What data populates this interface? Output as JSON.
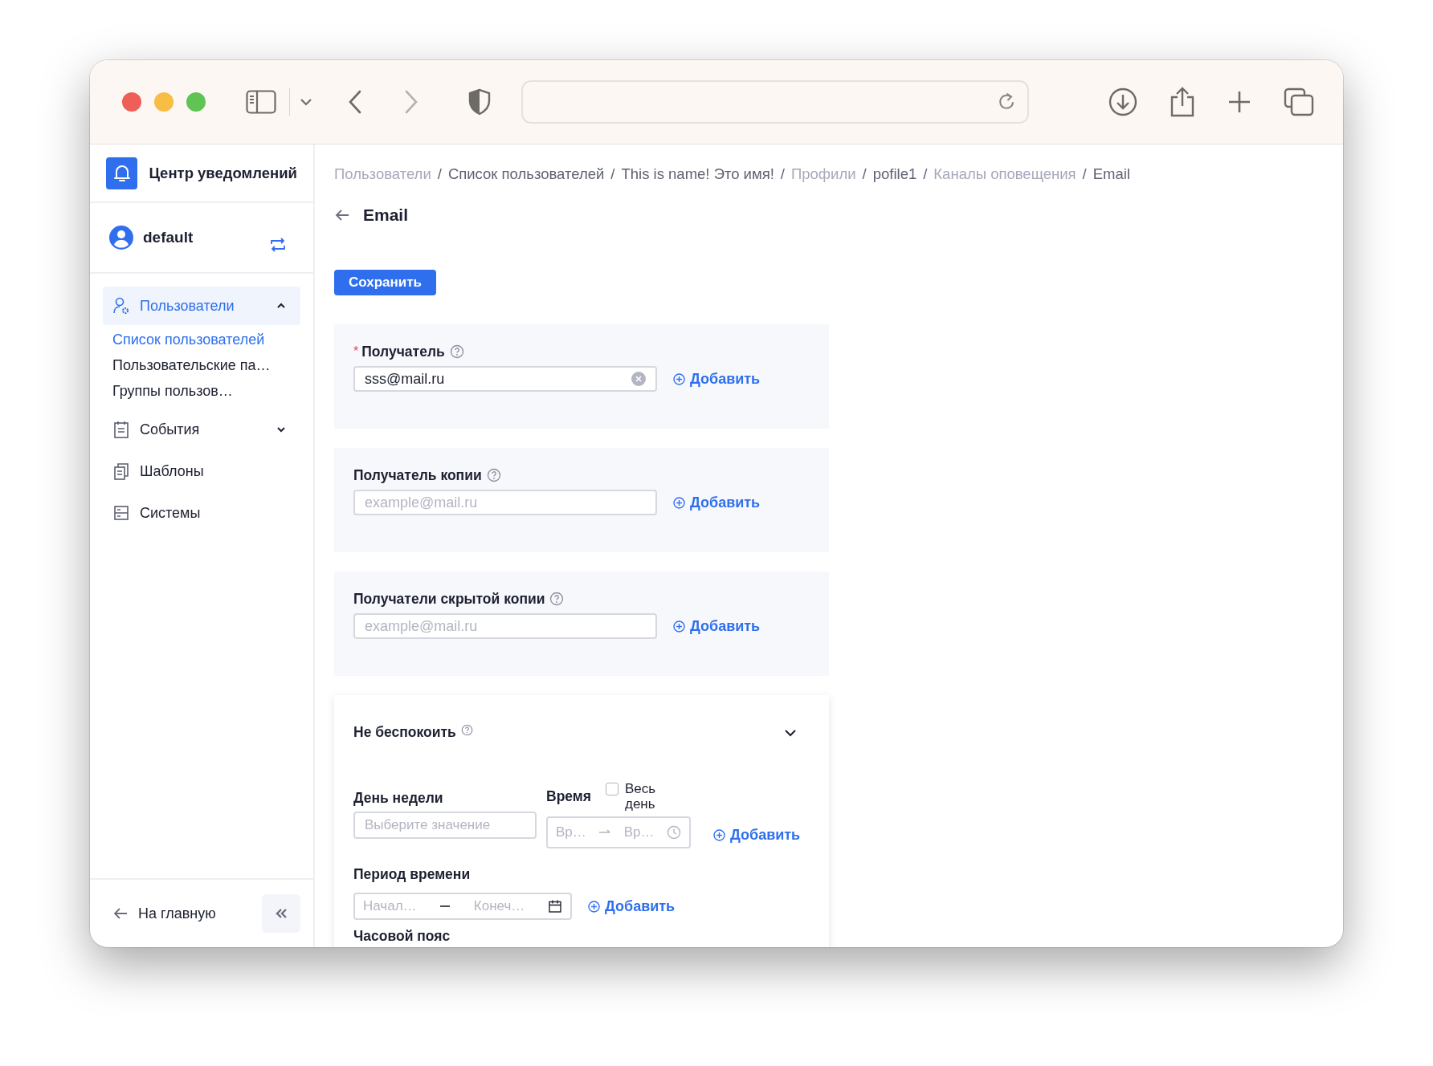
{
  "sidebar": {
    "app_title": "Центр уведомлений",
    "user": {
      "name": "default"
    },
    "nav": [
      {
        "label": "Пользователи",
        "kind": "users",
        "selected": true,
        "expanded": true,
        "children": [
          {
            "label": "Список пользователей",
            "selected": true
          },
          {
            "label": "Пользовательские па…",
            "selected": false
          },
          {
            "label": "Группы пользов…",
            "selected": false
          }
        ]
      },
      {
        "label": "События",
        "kind": "events",
        "selected": false,
        "expanded": false
      },
      {
        "label": "Шаблоны",
        "kind": "templates",
        "selected": false
      },
      {
        "label": "Системы",
        "kind": "systems",
        "selected": false
      }
    ],
    "back_link": "На главную"
  },
  "breadcrumb_separator": "/",
  "required_mark": "*",
  "breadcrumbs": [
    {
      "label": "Пользователи",
      "link": true
    },
    {
      "label": "Список пользователей",
      "link": false
    },
    {
      "label": "This is name! Это имя!",
      "link": false
    },
    {
      "label": "Профили",
      "link": true
    },
    {
      "label": "pofile1",
      "link": false
    },
    {
      "label": "Каналы оповещения",
      "link": true
    },
    {
      "label": "Email",
      "link": false
    }
  ],
  "page": {
    "title": "Email",
    "save_button": "Сохранить"
  },
  "recipient_fields": [
    {
      "label": "Получатель",
      "required": true,
      "value": "sss@mail.ru",
      "add_label": "Добавить"
    },
    {
      "label": "Получатель копии",
      "required": false,
      "placeholder": "example@mail.ru",
      "add_label": "Добавить"
    },
    {
      "label": "Получатели скрытой копии",
      "required": false,
      "placeholder": "example@mail.ru",
      "add_label": "Добавить"
    }
  ],
  "do_not_disturb": {
    "title": "Не беспокоить",
    "expanded": true,
    "weekday": {
      "label": "День недели",
      "placeholder": "Выберите значение"
    },
    "time": {
      "label": "Время",
      "all_day": {
        "label": "Весь день",
        "checked": false
      },
      "start_placeholder": "Вр…",
      "end_placeholder": "Вр…",
      "add_label": "Добавить"
    },
    "period": {
      "label": "Период времени",
      "start_placeholder": "Начал…",
      "end_placeholder": "Конеч…",
      "add_label": "Добавить"
    },
    "timezone": {
      "label": "Часовой пояс"
    }
  }
}
